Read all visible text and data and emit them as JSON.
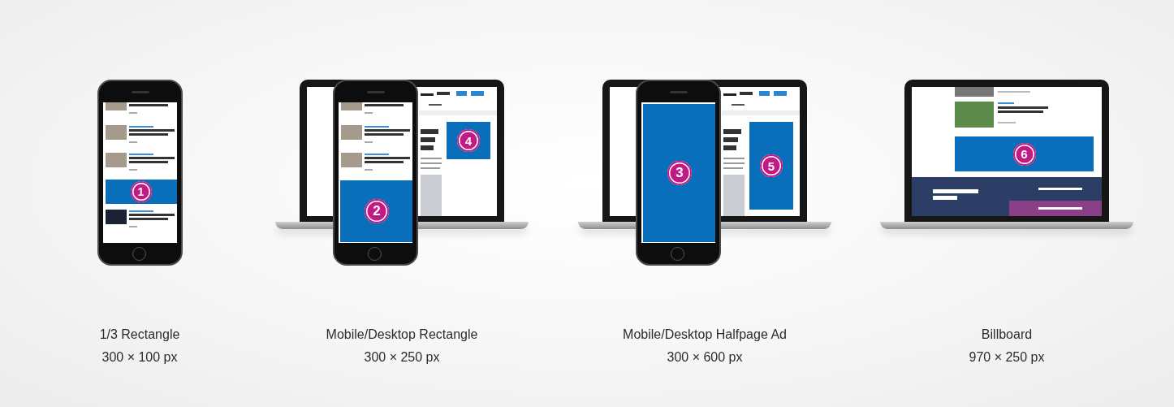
{
  "formats": [
    {
      "title": "1/3 Rectangle",
      "size": "300 × 100 px",
      "phone_ad": {
        "kind": "rectangle",
        "number": "1"
      }
    },
    {
      "title": "Mobile/Desktop Rectangle",
      "size": "300 × 250 px",
      "phone_ad": {
        "kind": "medium",
        "number": "2"
      },
      "laptop_ad": {
        "kind": "medium",
        "number": "4"
      }
    },
    {
      "title": "Mobile/Desktop Halfpage Ad",
      "size": "300 × 600 px",
      "phone_ad": {
        "kind": "halfpage",
        "number": "3"
      },
      "laptop_ad": {
        "kind": "halfpage",
        "number": "5"
      }
    },
    {
      "title": "Billboard",
      "size": "970 × 250 px",
      "laptop_ad": {
        "kind": "billboard",
        "number": "6"
      }
    }
  ]
}
